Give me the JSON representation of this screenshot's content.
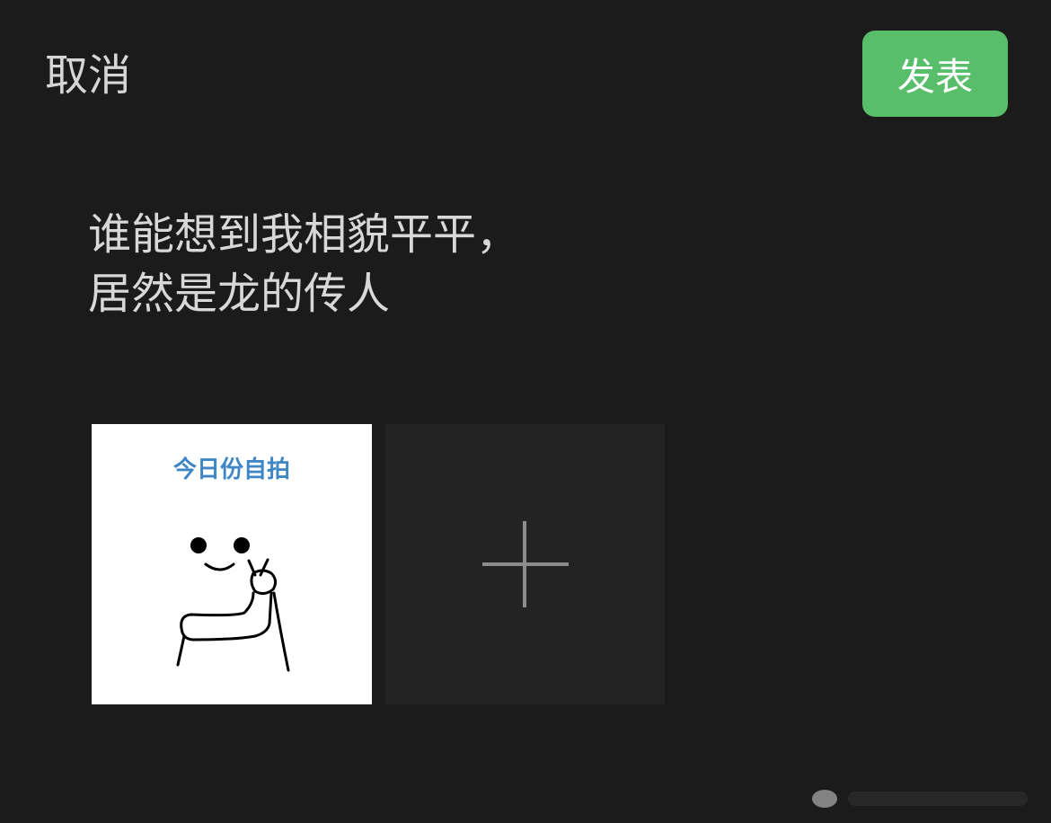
{
  "header": {
    "cancel_label": "取消",
    "publish_label": "发表"
  },
  "post": {
    "text_line1": "谁能想到我相貌平平，",
    "text_line2": "居然是龙的传人"
  },
  "attachments": {
    "image_caption": "今日份自拍",
    "add_icon": "plus-icon"
  },
  "colors": {
    "background": "#1b1b1b",
    "accent": "#58be6a",
    "caption_blue": "#3f86c4",
    "add_tile": "#232323"
  }
}
